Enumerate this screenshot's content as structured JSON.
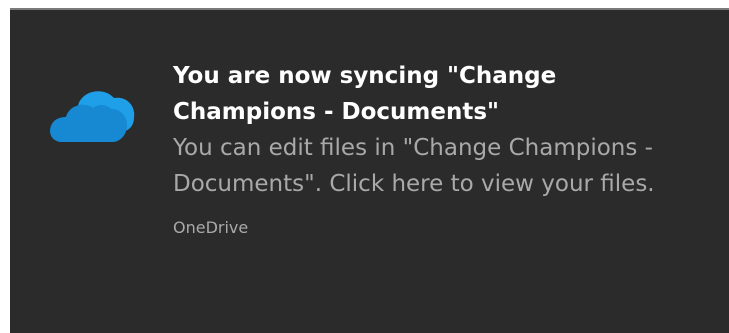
{
  "notification": {
    "title": "You are now syncing \"Change Champions - Documents\"",
    "body": "You can edit files in \"Change Champions - Documents\". Click here to view your files.",
    "source": "OneDrive",
    "icon": "onedrive-cloud-icon",
    "colors": {
      "background": "#2b2b2b",
      "title": "#ffffff",
      "body": "#a9a9a9",
      "cloud_light": "#1e9fe8",
      "cloud_dark": "#0364b8"
    }
  }
}
